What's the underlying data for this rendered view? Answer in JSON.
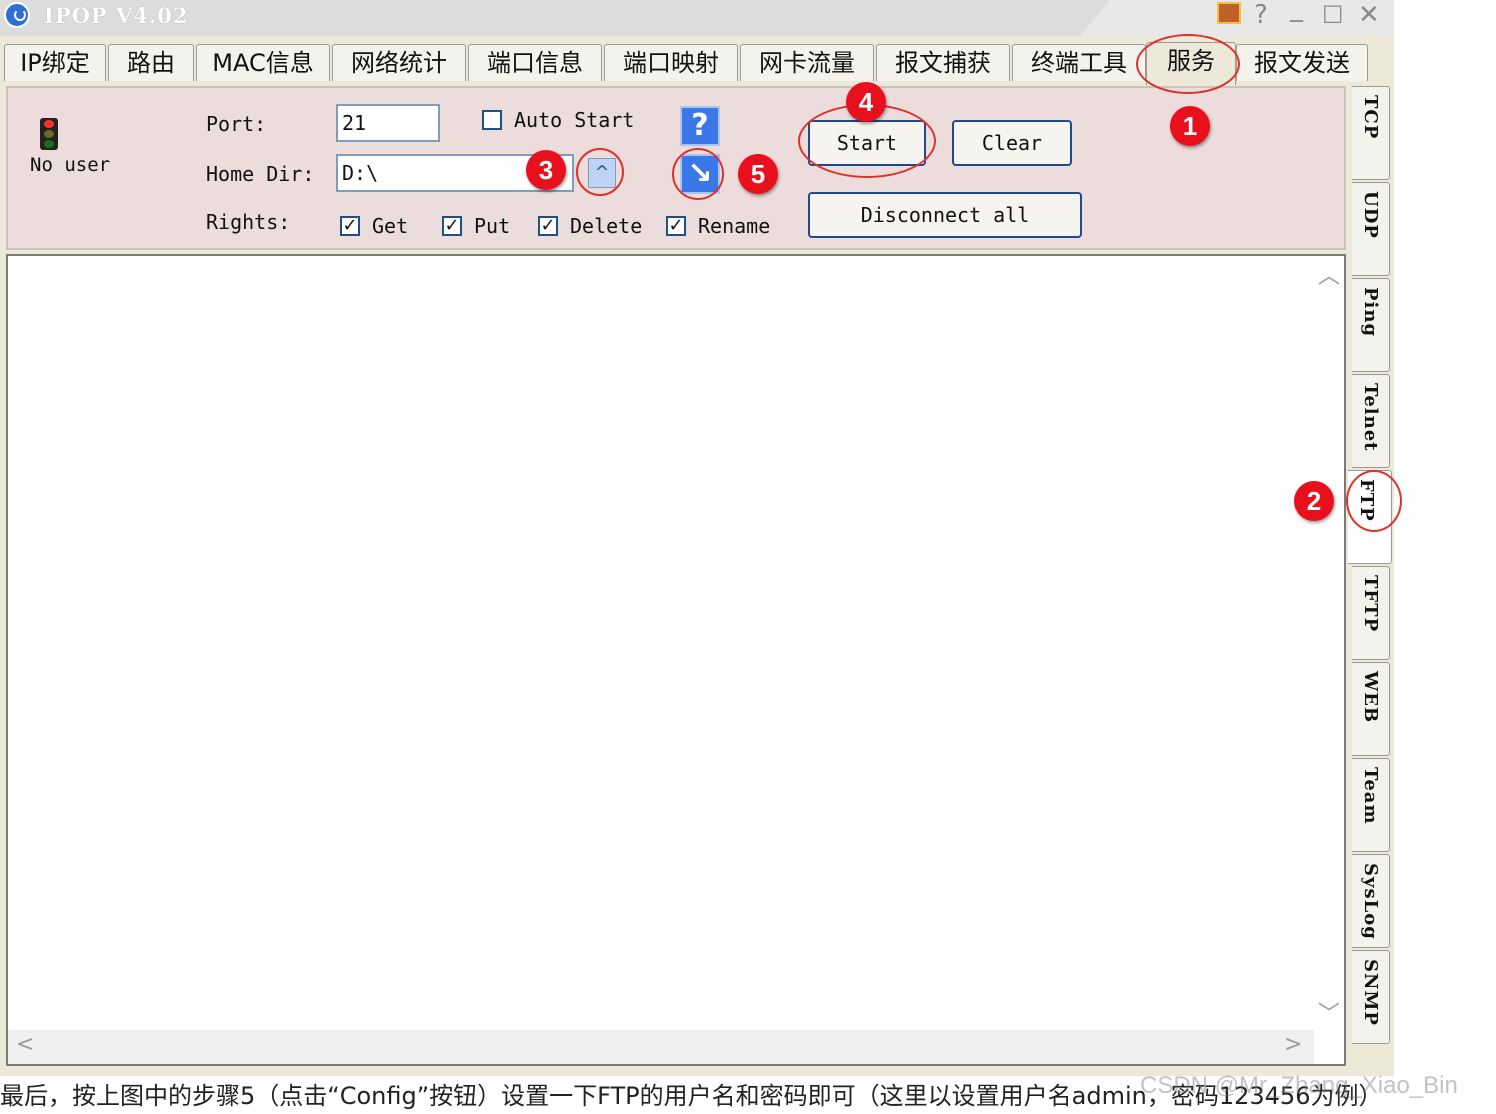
{
  "window": {
    "title": "IPOP V4.02",
    "buttons": {
      "help": "?",
      "minimize": "_",
      "maximize": "☐",
      "close": "✕"
    }
  },
  "tabs": [
    "IP绑定",
    "路由",
    "MAC信息",
    "网络统计",
    "端口信息",
    "端口映射",
    "网卡流量",
    "报文捕获",
    "终端工具",
    "服务",
    "报文发送"
  ],
  "active_tab": "服务",
  "side_tabs": [
    "TCP",
    "UDP",
    "Ping",
    "Telnet",
    "FTP",
    "TFTP",
    "WEB",
    "Team",
    "SysLog",
    "SNMP"
  ],
  "active_side_tab": "FTP",
  "ftp": {
    "status_text": "No user",
    "port_label": "Port:",
    "port_value": "21",
    "auto_start_label": "Auto Start",
    "home_dir_label": "Home Dir:",
    "home_dir_value": "D:\\",
    "rights_label": "Rights:",
    "rights": [
      {
        "label": "Get",
        "checked": true
      },
      {
        "label": "Put",
        "checked": true
      },
      {
        "label": "Delete",
        "checked": true
      },
      {
        "label": "Rename",
        "checked": true
      }
    ],
    "help_glyph": "?",
    "config_glyph": "↘",
    "browse_glyph": "^",
    "start_label": "Start",
    "clear_label": "Clear",
    "disconnect_label": "Disconnect all"
  },
  "annotations": [
    "1",
    "2",
    "3",
    "4",
    "5"
  ],
  "caption": "最后，按上图中的步骤5（点击“Config”按钮）设置一下FTP的用户名和密码即可（这里以设置用户名admin，密码123456为例）",
  "watermark": "CSDN @Mr_Zhang_Xiao_Bin",
  "colors": {
    "panel_bg": "#ecdcdc",
    "annotation_red": "#e8101c",
    "accent_blue": "#3b78e7"
  }
}
